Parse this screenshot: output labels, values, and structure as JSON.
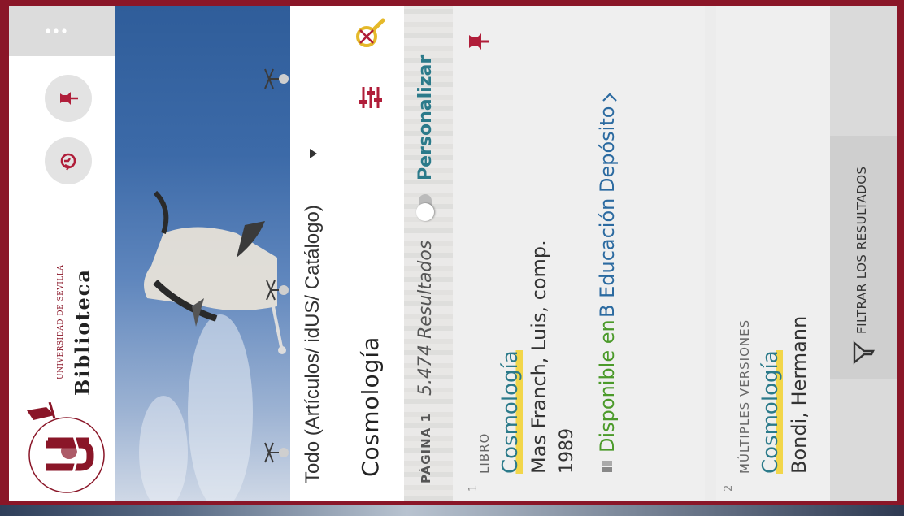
{
  "header": {
    "logo_title": "Biblioteca",
    "logo_university": "UNIVERSIDAD DE SEVILLA",
    "logo_ring": "UNIVERSIDAD DE SEVILLA",
    "menu_icon": "more-vertical-icon",
    "actions": [
      {
        "name": "pin-button",
        "icon": "pin-icon"
      },
      {
        "name": "history-button",
        "icon": "history-icon"
      }
    ]
  },
  "search": {
    "scope_label": "Todo (Artículos/ idUS/ Catálogo)",
    "query": "Cosmología",
    "clear_icon": "search-clear-icon",
    "filters_icon": "sliders-icon"
  },
  "results": {
    "page_label": "PÁGINA 1",
    "count_label": "5.474 Resultados",
    "personalize_label": "Personalizar",
    "items": [
      {
        "index": "1",
        "type": "LIBRO",
        "title": "Cosmología",
        "author": "Mas Franch, Luis, comp.",
        "year": "1989",
        "availability": "Disponible en",
        "location": "B Educación",
        "shelf": "Depósito"
      },
      {
        "index": "2",
        "type": "MÚLTIPLES VERSIONES",
        "title": "Cosmología",
        "author": "Bondi, Hermann"
      }
    ]
  },
  "filter_button": {
    "label": "FILTRAR LOS RESULTADOS",
    "icon": "funnel-icon"
  },
  "colors": {
    "brand": "#8a1628",
    "accent": "#2b7a8a",
    "available": "#4b9a2a",
    "location": "#2b6aa0",
    "highlight": "#f2d64a"
  }
}
